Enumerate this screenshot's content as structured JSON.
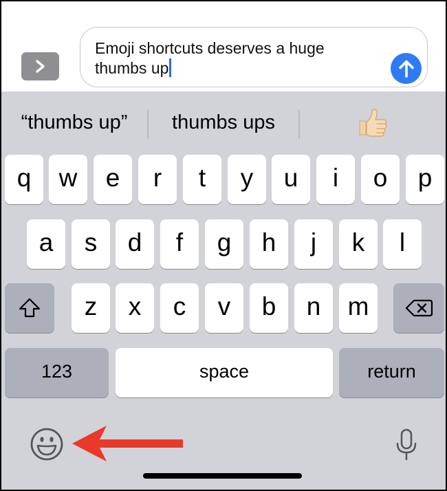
{
  "compose": {
    "message_text": "Emoji shortcuts deserves a huge\nthumbs up"
  },
  "predictions": [
    {
      "label": "“thumbs up”"
    },
    {
      "label": "thumbs ups"
    },
    {
      "label": "👍🏻",
      "icon": "thumbs-up-emoji"
    }
  ],
  "keyboard": {
    "row1": [
      "q",
      "w",
      "e",
      "r",
      "t",
      "y",
      "u",
      "i",
      "o",
      "p"
    ],
    "row2": [
      "a",
      "s",
      "d",
      "f",
      "g",
      "h",
      "j",
      "k",
      "l"
    ],
    "row3": [
      "z",
      "x",
      "c",
      "v",
      "b",
      "n",
      "m"
    ],
    "numbers_label": "123",
    "space_label": "space",
    "return_label": "return"
  },
  "icons": {
    "expand": "chevron-right-icon",
    "send": "arrow-up-icon",
    "shift": "shift-icon",
    "delete": "backspace-icon",
    "emoji": "smiley-icon",
    "dictation": "microphone-icon",
    "annotation": "red-arrow-icon"
  },
  "colors": {
    "send_blue": "#2f7bf6",
    "caret": "#2f6ce5",
    "annotation_red": "#e8392a",
    "keyboard_bg": "#d1d3d9"
  }
}
